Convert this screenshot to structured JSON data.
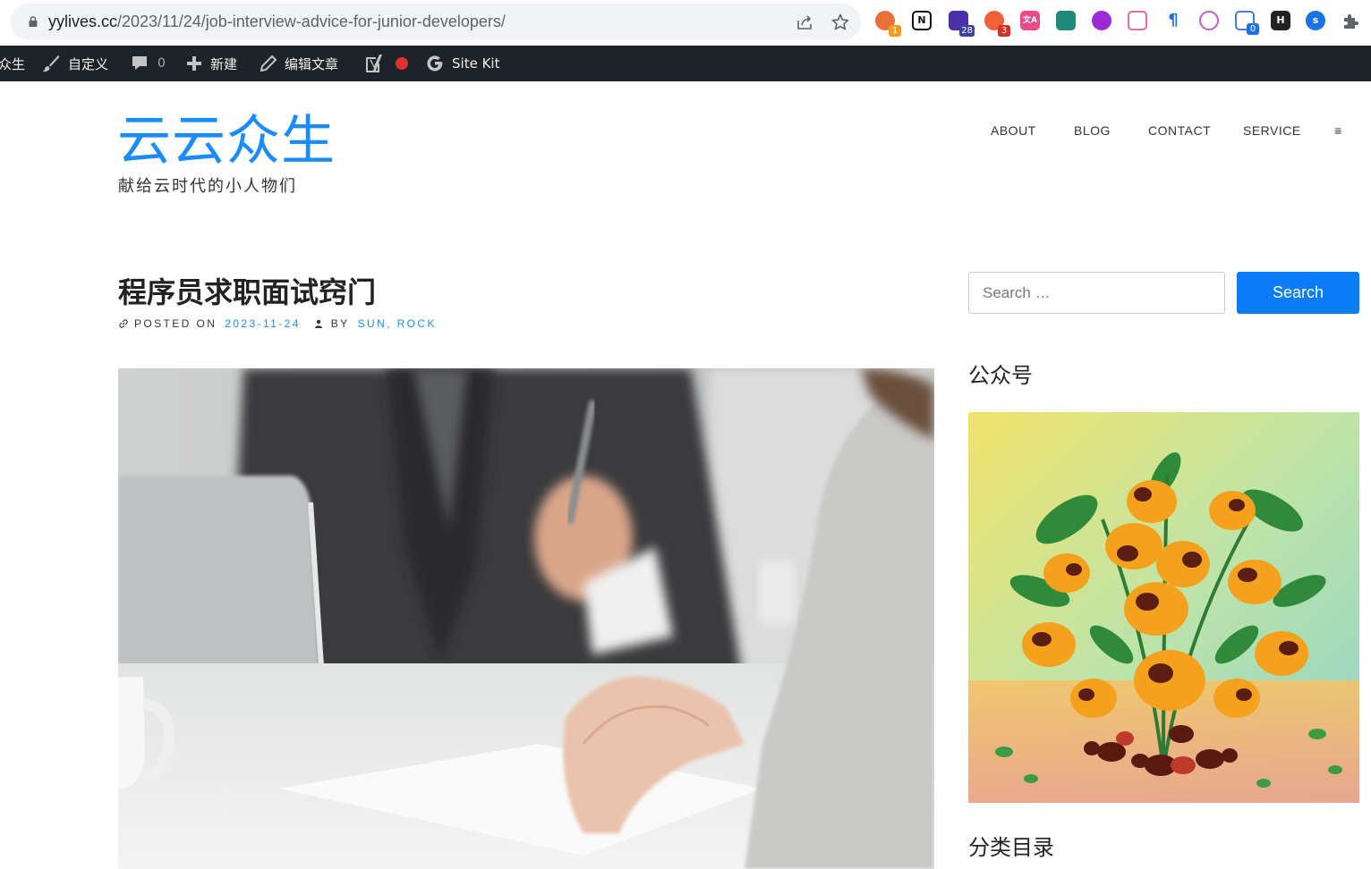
{
  "browser": {
    "url_host": "yylives.cc",
    "url_path": "/2023/11/24/job-interview-advice-for-junior-developers/",
    "extension_badges": {
      "first": "1",
      "second": "28",
      "third": "3",
      "last": "0"
    },
    "extension_labels": {
      "notion": "N",
      "translate": "文A",
      "hf": "H",
      "boost": "ꜱ"
    }
  },
  "adminbar": {
    "site_label": "众生",
    "customize": "自定义",
    "comments_count": "0",
    "new": "新建",
    "edit_post": "编辑文章",
    "site_kit": "Site Kit"
  },
  "site": {
    "title": "云云众生",
    "description": "献给云时代的小人物们"
  },
  "nav": {
    "items": [
      "ABOUT",
      "BLOG",
      "CONTACT",
      "SERVICE"
    ],
    "menu_glyph": "≡"
  },
  "post": {
    "title": "程序员求职面试窍门",
    "posted_on_label": "POSTED ON",
    "date": "2023-11-24",
    "by_label": "BY",
    "authors": "SUN, ROCK"
  },
  "sidebar": {
    "search_placeholder": "Search …",
    "search_button": "Search",
    "widget_wechat": "公众号",
    "widget_categories": "分类目录"
  },
  "colors": {
    "accent": "#1a8cff",
    "button": "#0a7cf5",
    "adminbar": "#1d2327"
  }
}
